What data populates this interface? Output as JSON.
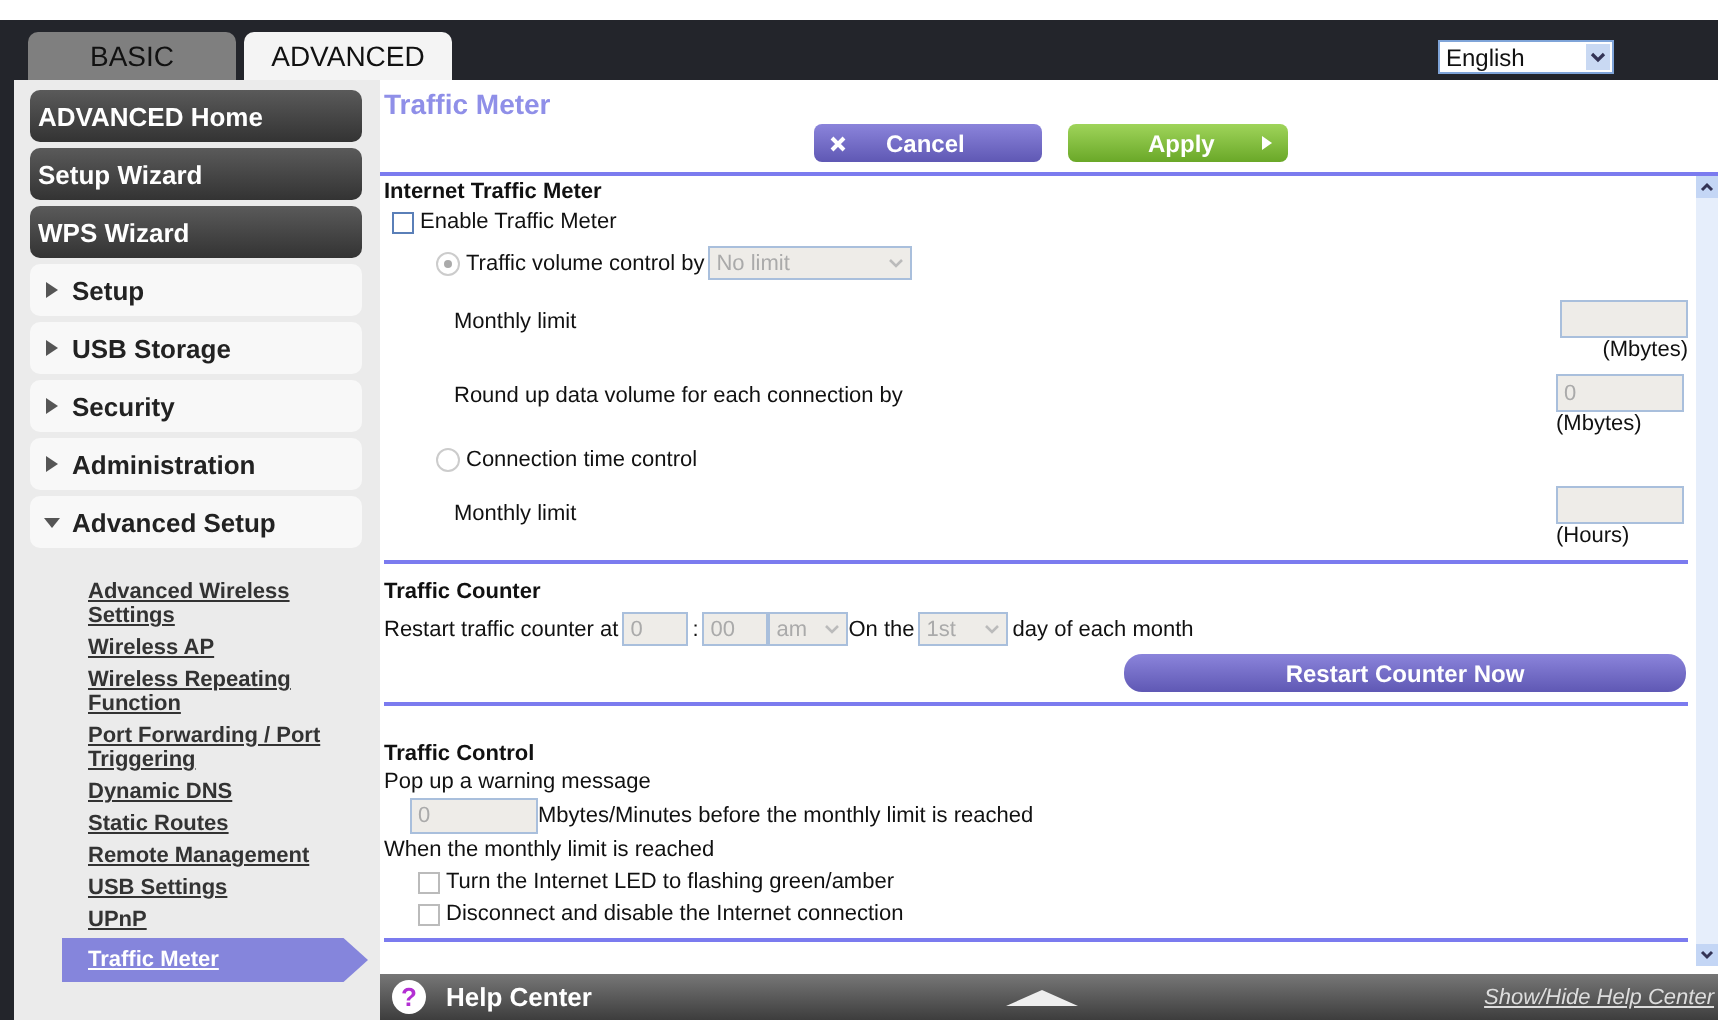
{
  "tabs": [
    {
      "label": "BASIC",
      "selected": false
    },
    {
      "label": "ADVANCED",
      "selected": true
    }
  ],
  "language": {
    "value": "English"
  },
  "sidebar": {
    "items": [
      {
        "label": "ADVANCED Home",
        "kind": "main"
      },
      {
        "label": "Setup Wizard",
        "kind": "main"
      },
      {
        "label": "WPS Wizard",
        "kind": "main"
      },
      {
        "label": "Setup",
        "kind": "group",
        "expanded": false
      },
      {
        "label": "USB Storage",
        "kind": "group",
        "expanded": false
      },
      {
        "label": "Security",
        "kind": "group",
        "expanded": false
      },
      {
        "label": "Administration",
        "kind": "group",
        "expanded": false
      },
      {
        "label": "Advanced Setup",
        "kind": "group",
        "expanded": true,
        "children": [
          {
            "label": "Advanced Wireless Settings",
            "selected": false
          },
          {
            "label": "Wireless AP",
            "selected": false
          },
          {
            "label": "Wireless Repeating Function",
            "selected": false
          },
          {
            "label": "Port Forwarding / Port Triggering",
            "selected": false
          },
          {
            "label": "Dynamic DNS",
            "selected": false
          },
          {
            "label": "Static Routes",
            "selected": false
          },
          {
            "label": "Remote Management",
            "selected": false
          },
          {
            "label": "USB Settings",
            "selected": false
          },
          {
            "label": "UPnP",
            "selected": false
          },
          {
            "label": "Traffic Meter",
            "selected": true
          }
        ]
      }
    ]
  },
  "page_title": "Traffic Meter",
  "buttons": {
    "cancel": "Cancel",
    "apply": "Apply"
  },
  "internet_traffic_meter": {
    "heading": "Internet Traffic Meter",
    "enable": {
      "label": "Enable Traffic Meter",
      "checked": false
    },
    "volume_control": {
      "label": "Traffic volume control by",
      "selected": true,
      "dropdown": "No limit"
    },
    "volume_monthly_limit": {
      "label": "Monthly limit",
      "unit": "(Mbytes)"
    },
    "round_up": {
      "label": "Round up data volume for each connection by",
      "value": "0",
      "unit": "(Mbytes)"
    },
    "time_control": {
      "label": "Connection time control",
      "selected": false
    },
    "time_monthly_limit": {
      "label": "Monthly limit",
      "unit": "(Hours)"
    }
  },
  "traffic_counter": {
    "heading": "Traffic Counter",
    "restart_label": "Restart traffic counter at",
    "hour": "0",
    "separator": ":",
    "minute": "00",
    "ampm": "am",
    "on_the": "On the",
    "day": "1st",
    "day_suffix": "day of each month",
    "restart_button": "Restart Counter Now"
  },
  "traffic_control": {
    "heading": "Traffic Control",
    "popup_label": "Pop up a warning message",
    "popup_value": "0",
    "popup_suffix": "Mbytes/Minutes before the monthly limit is reached",
    "when_label": "When the monthly limit is reached",
    "options": [
      {
        "label": "Turn the Internet LED to flashing green/amber",
        "checked": false
      },
      {
        "label": "Disconnect and disable the Internet connection",
        "checked": false
      }
    ]
  },
  "help_bar": {
    "title": "Help Center",
    "icon": "?",
    "toggle": "Show/Hide Help Center"
  }
}
